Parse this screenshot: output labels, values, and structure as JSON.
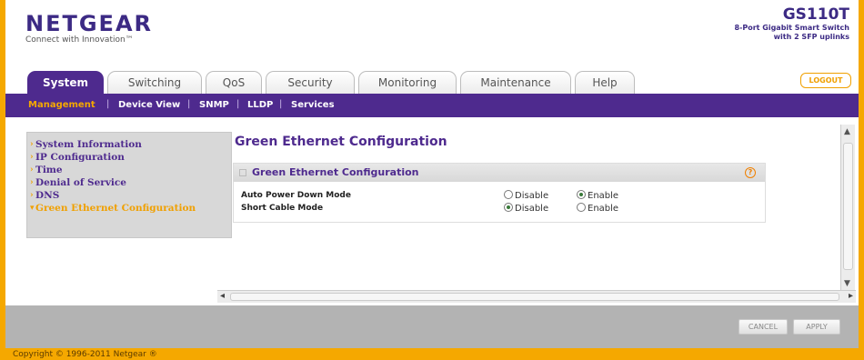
{
  "brand": {
    "name": "NETGEAR",
    "tagline": "Connect with Innovation™"
  },
  "model": {
    "name": "GS110T",
    "description": "8-Port Gigabit Smart Switch with 2 SFP uplinks"
  },
  "logout_label": "LOGOUT",
  "tabs": [
    {
      "label": "System",
      "active": true
    },
    {
      "label": "Switching"
    },
    {
      "label": "QoS"
    },
    {
      "label": "Security"
    },
    {
      "label": "Monitoring"
    },
    {
      "label": "Maintenance"
    },
    {
      "label": "Help"
    }
  ],
  "subnav": [
    {
      "label": "Management",
      "active": true
    },
    {
      "label": "Device View"
    },
    {
      "label": "SNMP"
    },
    {
      "label": "LLDP"
    },
    {
      "label": "Services"
    }
  ],
  "sidebar": {
    "items": [
      {
        "label": "System Information"
      },
      {
        "label": "IP Configuration"
      },
      {
        "label": "Time"
      },
      {
        "label": "Denial of Service"
      },
      {
        "label": "DNS"
      },
      {
        "label": "Green Ethernet Configuration",
        "active": true
      }
    ]
  },
  "main": {
    "page_title": "Green Ethernet Configuration",
    "panel_title": "Green Ethernet Configuration",
    "help_glyph": "?",
    "rows": [
      {
        "label": "Auto Power Down Mode",
        "options": [
          "Disable",
          "Enable"
        ],
        "selected": "Enable"
      },
      {
        "label": "Short Cable Mode",
        "options": [
          "Disable",
          "Enable"
        ],
        "selected": "Disable"
      }
    ]
  },
  "buttons": {
    "cancel": "CANCEL",
    "apply": "APPLY"
  },
  "footer": {
    "copyright": "Copyright © 1996-2011 Netgear ®"
  },
  "colors": {
    "brand_purple": "#4e2a8e",
    "accent_orange": "#f5a800"
  }
}
